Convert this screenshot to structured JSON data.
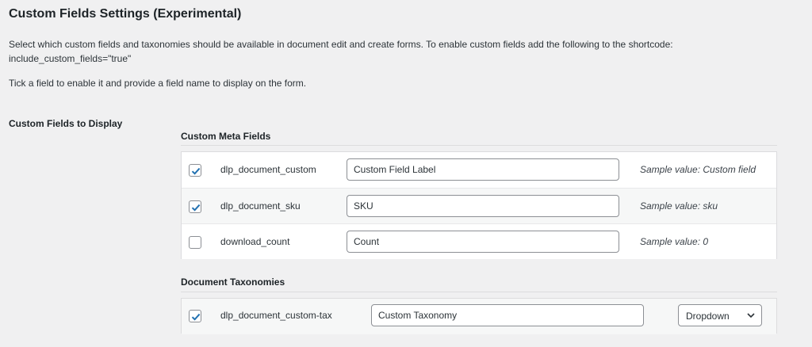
{
  "header": {
    "title": "Custom Fields Settings (Experimental)",
    "desc_line1": "Select which custom fields and taxonomies should be available in document edit and create forms. To enable custom fields add the following to the shortcode:",
    "desc_line2": "include_custom_fields=\"true\"",
    "desc_line3": "Tick a field to enable it and provide a field name to display on the form."
  },
  "section_label": "Custom Fields to Display",
  "meta_fields": {
    "title": "Custom Meta Fields",
    "rows": [
      {
        "checked": true,
        "name": "dlp_document_custom",
        "label_value": "Custom Field Label",
        "sample": "Sample value: Custom field"
      },
      {
        "checked": true,
        "name": "dlp_document_sku",
        "label_value": "SKU",
        "sample": "Sample value: sku"
      },
      {
        "checked": false,
        "name": "download_count",
        "label_value": "Count",
        "sample": "Sample value: 0"
      }
    ]
  },
  "taxonomies": {
    "title": "Document Taxonomies",
    "rows": [
      {
        "checked": true,
        "name": "dlp_document_custom-tax",
        "label_value": "Custom Taxonomy",
        "display_type": "Dropdown"
      }
    ]
  },
  "colors": {
    "checkmark": "#2271b1",
    "border": "#8c8f94",
    "background": "#f0f0f1"
  }
}
